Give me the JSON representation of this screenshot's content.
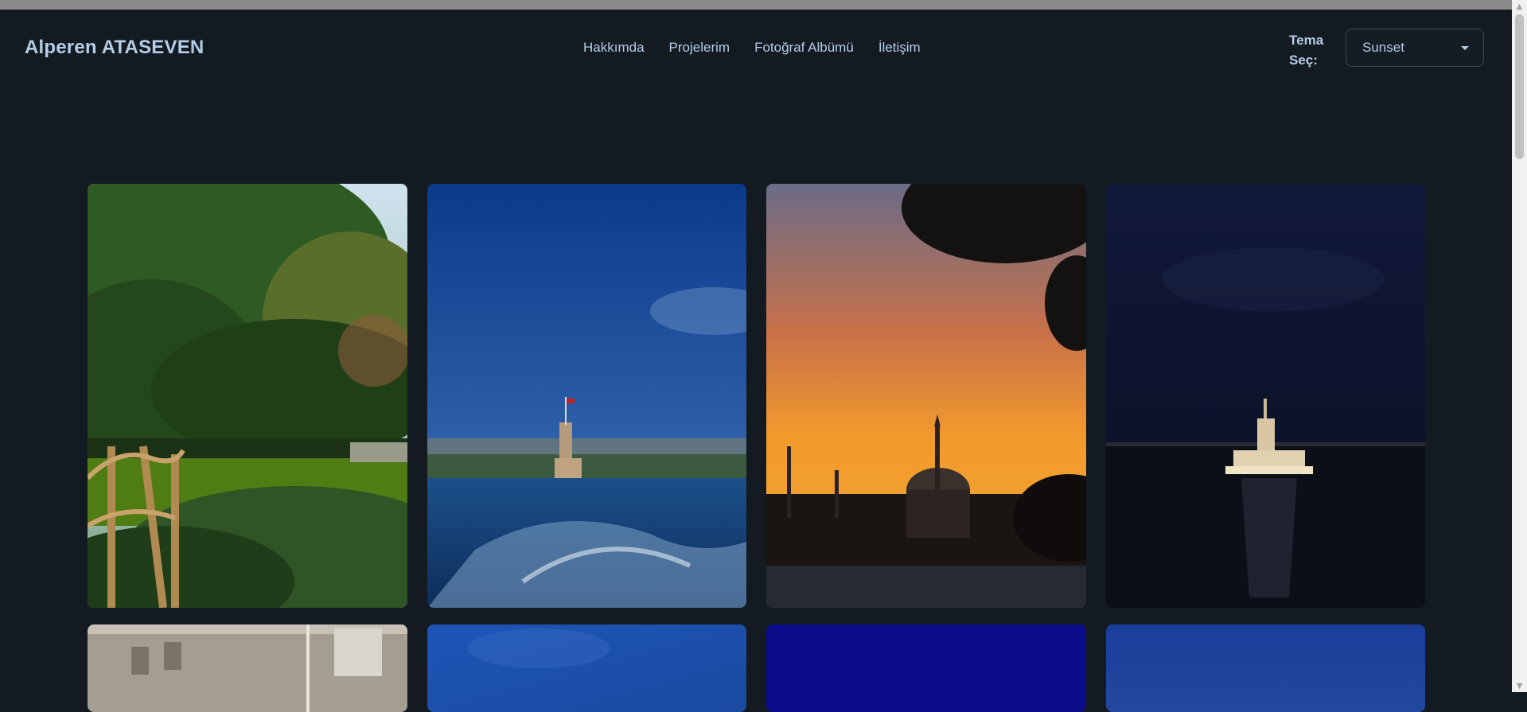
{
  "brand": "Alperen ATASEVEN",
  "nav": [
    "Hakkımda",
    "Projelerim",
    "Fotoğraf Albümü",
    "İletişim"
  ],
  "theme": {
    "label": "Tema Seç:",
    "selected": "Sunset"
  },
  "colors": {
    "background": "#131a21",
    "text": "#b5cde6",
    "border": "#3a4654"
  },
  "gallery": {
    "row1": [
      "forest-pond",
      "maidens-tower-day",
      "mosque-sunset",
      "maidens-tower-night"
    ],
    "row2": [
      "building-facade",
      "blue-sky",
      "deep-blue",
      "evening-blue"
    ]
  },
  "scrollbar": {
    "up_icon": "▲",
    "down_icon": "▼"
  }
}
